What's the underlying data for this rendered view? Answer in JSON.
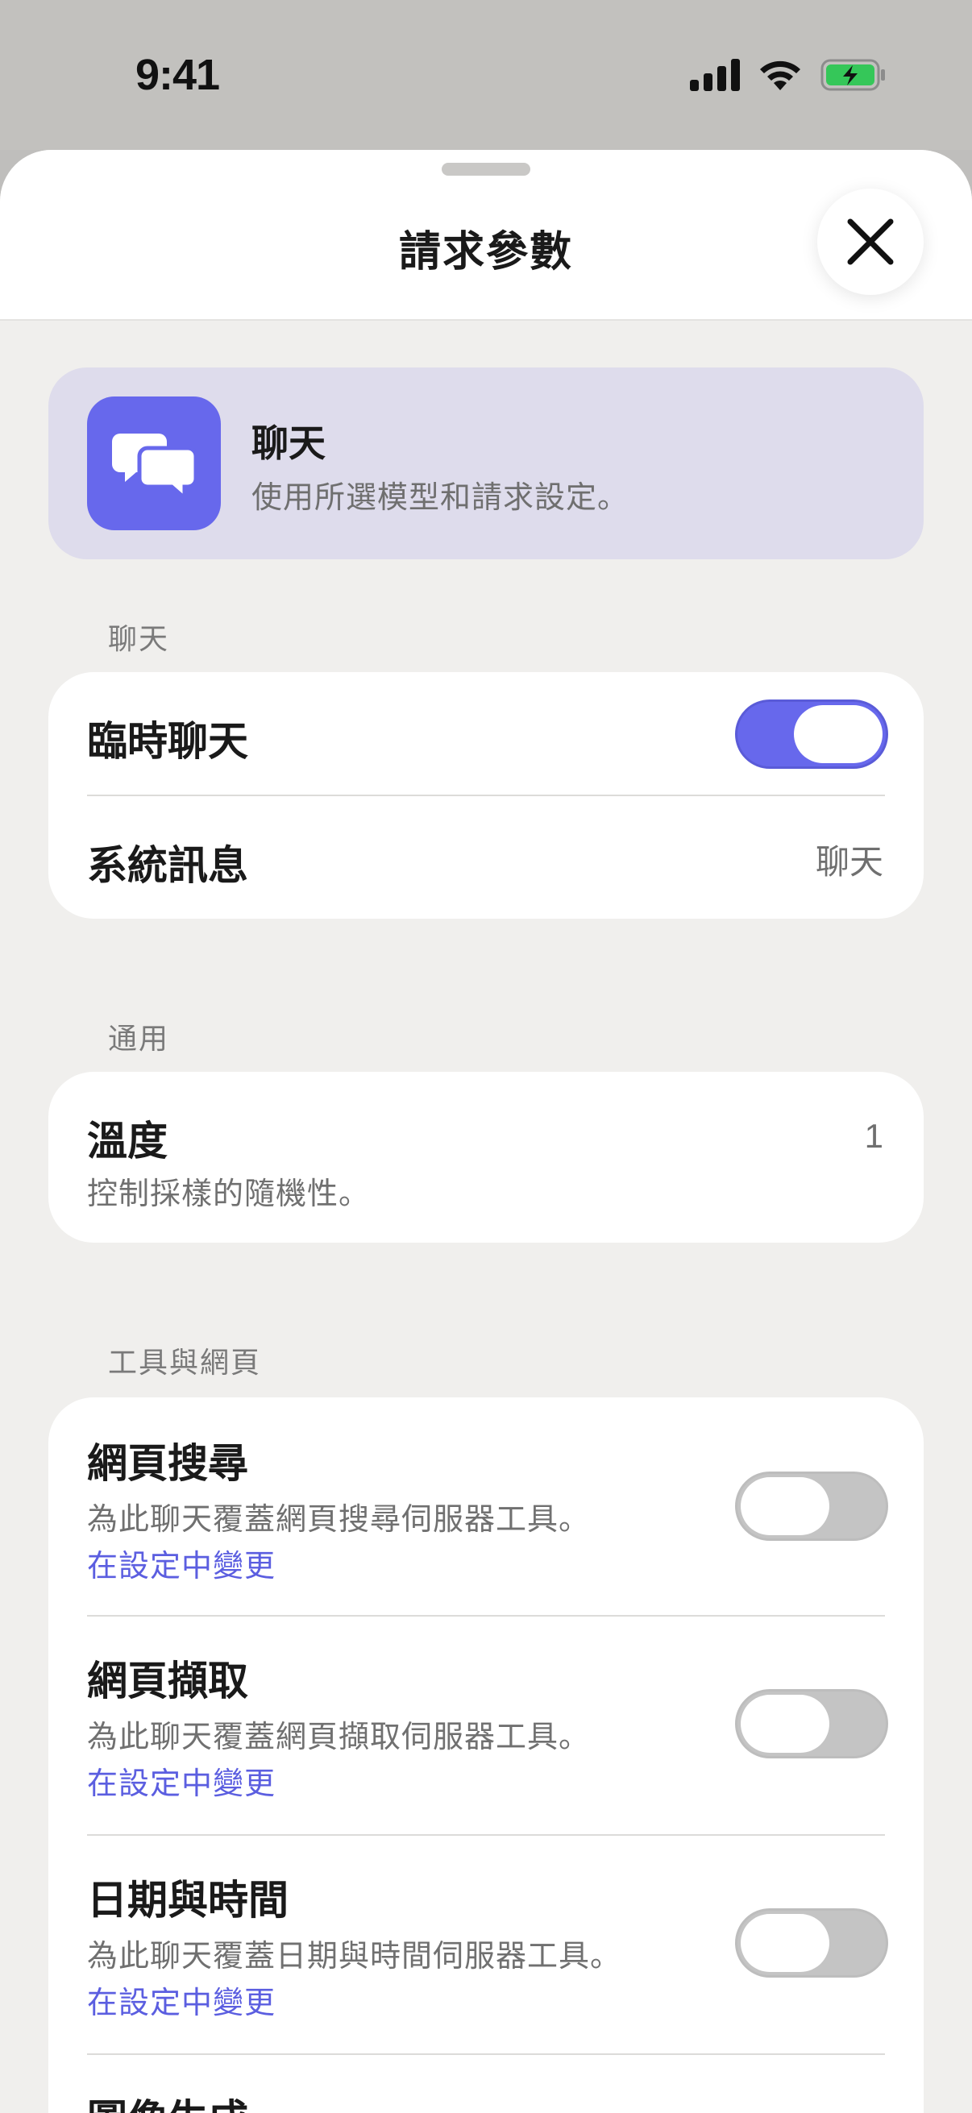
{
  "status_bar": {
    "time": "9:41"
  },
  "header": {
    "title": "請求參數",
    "close_icon": "close-x-icon"
  },
  "banner": {
    "icon": "chat-bubbles-icon",
    "title": "聊天",
    "subtitle": "使用所選模型和請求設定。"
  },
  "sections": {
    "chat": {
      "label": "聊天",
      "temporary_chat": {
        "label": "臨時聊天",
        "enabled": true
      },
      "system_message": {
        "label": "系統訊息",
        "value": "聊天"
      }
    },
    "general": {
      "label": "通用",
      "temperature": {
        "label": "溫度",
        "description": "控制採樣的隨機性。",
        "value": "1"
      }
    },
    "tools": {
      "label": "工具與網頁",
      "items": [
        {
          "label": "網頁搜尋",
          "description": "為此聊天覆蓋網頁搜尋伺服器工具。",
          "link": "在設定中變更",
          "enabled": false
        },
        {
          "label": "網頁擷取",
          "description": "為此聊天覆蓋網頁擷取伺服器工具。",
          "link": "在設定中變更",
          "enabled": false
        },
        {
          "label": "日期與時間",
          "description": "為此聊天覆蓋日期與時間伺服器工具。",
          "link": "在設定中變更",
          "enabled": false
        },
        {
          "label": "圖像生成"
        }
      ]
    }
  },
  "colors": {
    "accent": "#6768ec",
    "banner_bg": "#dedcec",
    "link": "#5b5ee0",
    "toggle_off": "#c4c4c4",
    "battery": "#35c759"
  }
}
